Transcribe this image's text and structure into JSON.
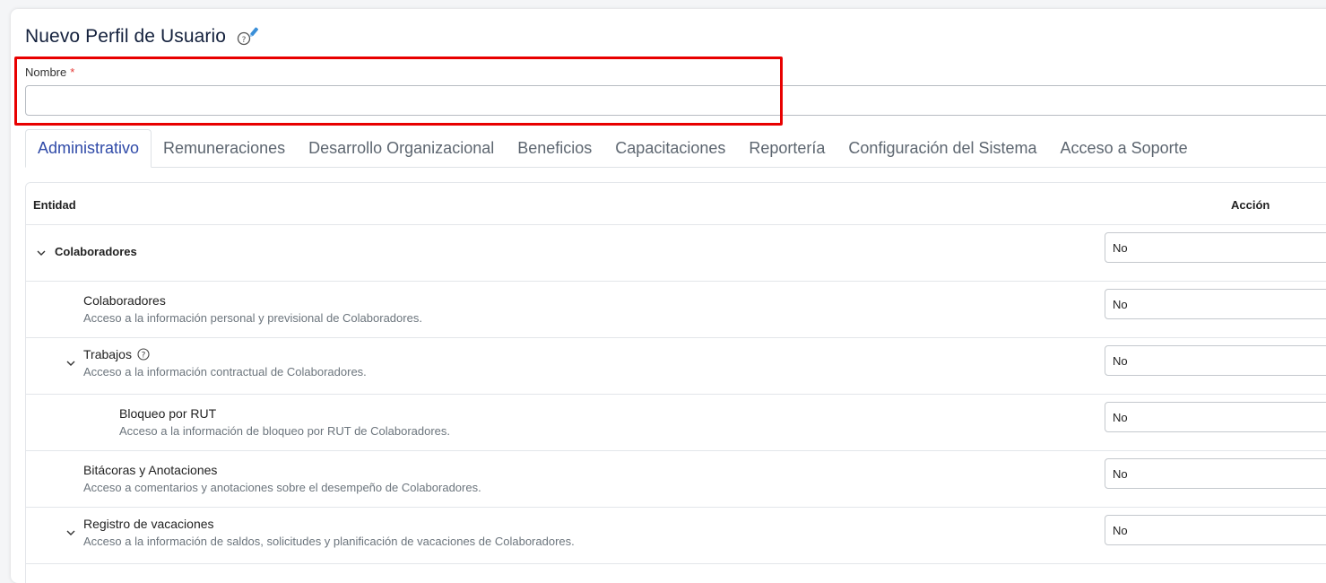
{
  "header": {
    "title": "Nuevo Perfil de Usuario"
  },
  "form": {
    "name_label": "Nombre",
    "required_mark": "*",
    "name_value": "",
    "name_placeholder": ""
  },
  "tabs": [
    {
      "label": "Administrativo",
      "active": true
    },
    {
      "label": "Remuneraciones"
    },
    {
      "label": "Desarrollo Organizacional"
    },
    {
      "label": "Beneficios"
    },
    {
      "label": "Capacitaciones"
    },
    {
      "label": "Reportería"
    },
    {
      "label": "Configuración del Sistema"
    },
    {
      "label": "Acceso a Soporte"
    }
  ],
  "table": {
    "col_entity": "Entidad",
    "col_action": "Acción",
    "rows": [
      {
        "name": "Colaboradores",
        "description": "",
        "value": "No"
      },
      {
        "name": "Colaboradores",
        "description": "Acceso a la información personal y previsional de Colaboradores.",
        "value": "No"
      },
      {
        "name": "Trabajos",
        "description": "Acceso a la información contractual de Colaboradores.",
        "value": "No"
      },
      {
        "name": "Bloqueo por RUT",
        "description": "Acceso a la información de bloqueo por RUT de Colaboradores.",
        "value": "No"
      },
      {
        "name": "Bitácoras y Anotaciones",
        "description": "Acceso a comentarios y anotaciones sobre el desempeño de Colaboradores.",
        "value": "No"
      },
      {
        "name": "Registro de vacaciones",
        "description": "Acceso a la información de saldos, solicitudes y planificación de vacaciones de Colaboradores.",
        "value": "No"
      }
    ]
  },
  "colors": {
    "title": "#14213d",
    "active_tab": "#2f4aa8",
    "highlight": "#e80000",
    "required": "#e53935"
  }
}
